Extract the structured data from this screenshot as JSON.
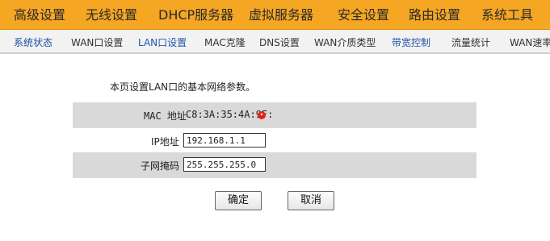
{
  "top_menu": [
    {
      "label": "高级设置"
    },
    {
      "label": "无线设置"
    },
    {
      "label": "DHCP服务器"
    },
    {
      "label": "虚拟服务器"
    },
    {
      "label": "安全设置"
    },
    {
      "label": "路由设置"
    },
    {
      "label": "系统工具"
    }
  ],
  "sub_menu": [
    {
      "label": "系统状态"
    },
    {
      "label": "WAN口设置"
    },
    {
      "label": "LAN口设置"
    },
    {
      "label": "MAC克隆"
    },
    {
      "label": "DNS设置"
    },
    {
      "label": "WAN介质类型"
    },
    {
      "label": "带宽控制"
    },
    {
      "label": "流量统计"
    },
    {
      "label": "WAN速率"
    }
  ],
  "page": {
    "description": "本页设置LAN口的基本网络参数。",
    "mac_label": "MAC 地址",
    "mac_value": "C8:3A:35:4A:9F:",
    "ip_label": "IP地址",
    "ip_value": "192.168.1.1",
    "mask_label": "子网掩码",
    "mask_value": "255.255.255.0"
  },
  "buttons": {
    "ok": "确定",
    "cancel": "取消"
  },
  "colors": {
    "topbar": "#f5a623",
    "subbar": "#f2f2f2",
    "shaded_row": "#d9d9d9"
  }
}
